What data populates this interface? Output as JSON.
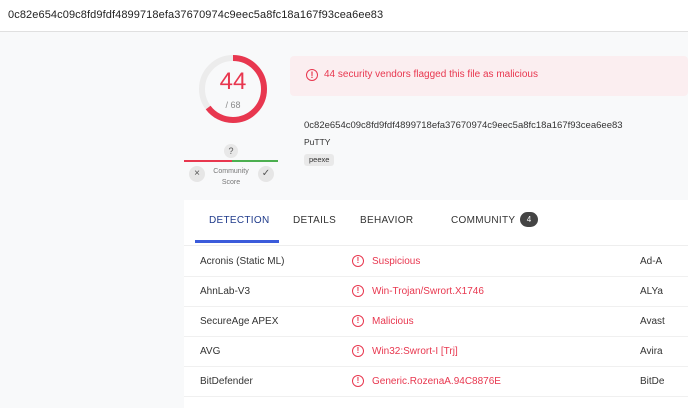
{
  "header": {
    "hash": "0c82e654c09c8fd9fdf4899718efa37670974c9eec5a8fc18a167f93cea6ee83"
  },
  "score": {
    "detections": "44",
    "total": "/ 68",
    "detection_fraction": 0.647
  },
  "community": {
    "question": "?",
    "label_line1": "Community",
    "label_line2": "Score",
    "down_icon": "×",
    "up_icon": "✓"
  },
  "alert": {
    "icon": "!",
    "text": "44 security vendors flagged this file as malicious"
  },
  "file": {
    "hash": "0c82e654c09c8fd9fdf4899718efa37670974c9eec5a8fc18a167f93cea6ee83",
    "name": "PuTTY",
    "tag": "peexe"
  },
  "tabs": [
    {
      "label": "DETECTION"
    },
    {
      "label": "DETAILS"
    },
    {
      "label": "BEHAVIOR"
    },
    {
      "label": "COMMUNITY"
    }
  ],
  "community_badge": "4",
  "detections": [
    {
      "engine": "Acronis (Static ML)",
      "result": "Suspicious",
      "engine2": "Ad-A"
    },
    {
      "engine": "AhnLab-V3",
      "result": "Win-Trojan/Swrort.X1746",
      "engine2": "ALYa"
    },
    {
      "engine": "SecureAge APEX",
      "result": "Malicious",
      "engine2": "Avast"
    },
    {
      "engine": "AVG",
      "result": "Win32:Swrort-I [Trj]",
      "engine2": "Avira"
    },
    {
      "engine": "BitDefender",
      "result": "Generic.RozenaA.94C8876E",
      "engine2": "BitDe"
    }
  ],
  "colors": {
    "malicious": "#e8374f",
    "accent": "#3b5bdb",
    "harmless": "#4caf50"
  }
}
